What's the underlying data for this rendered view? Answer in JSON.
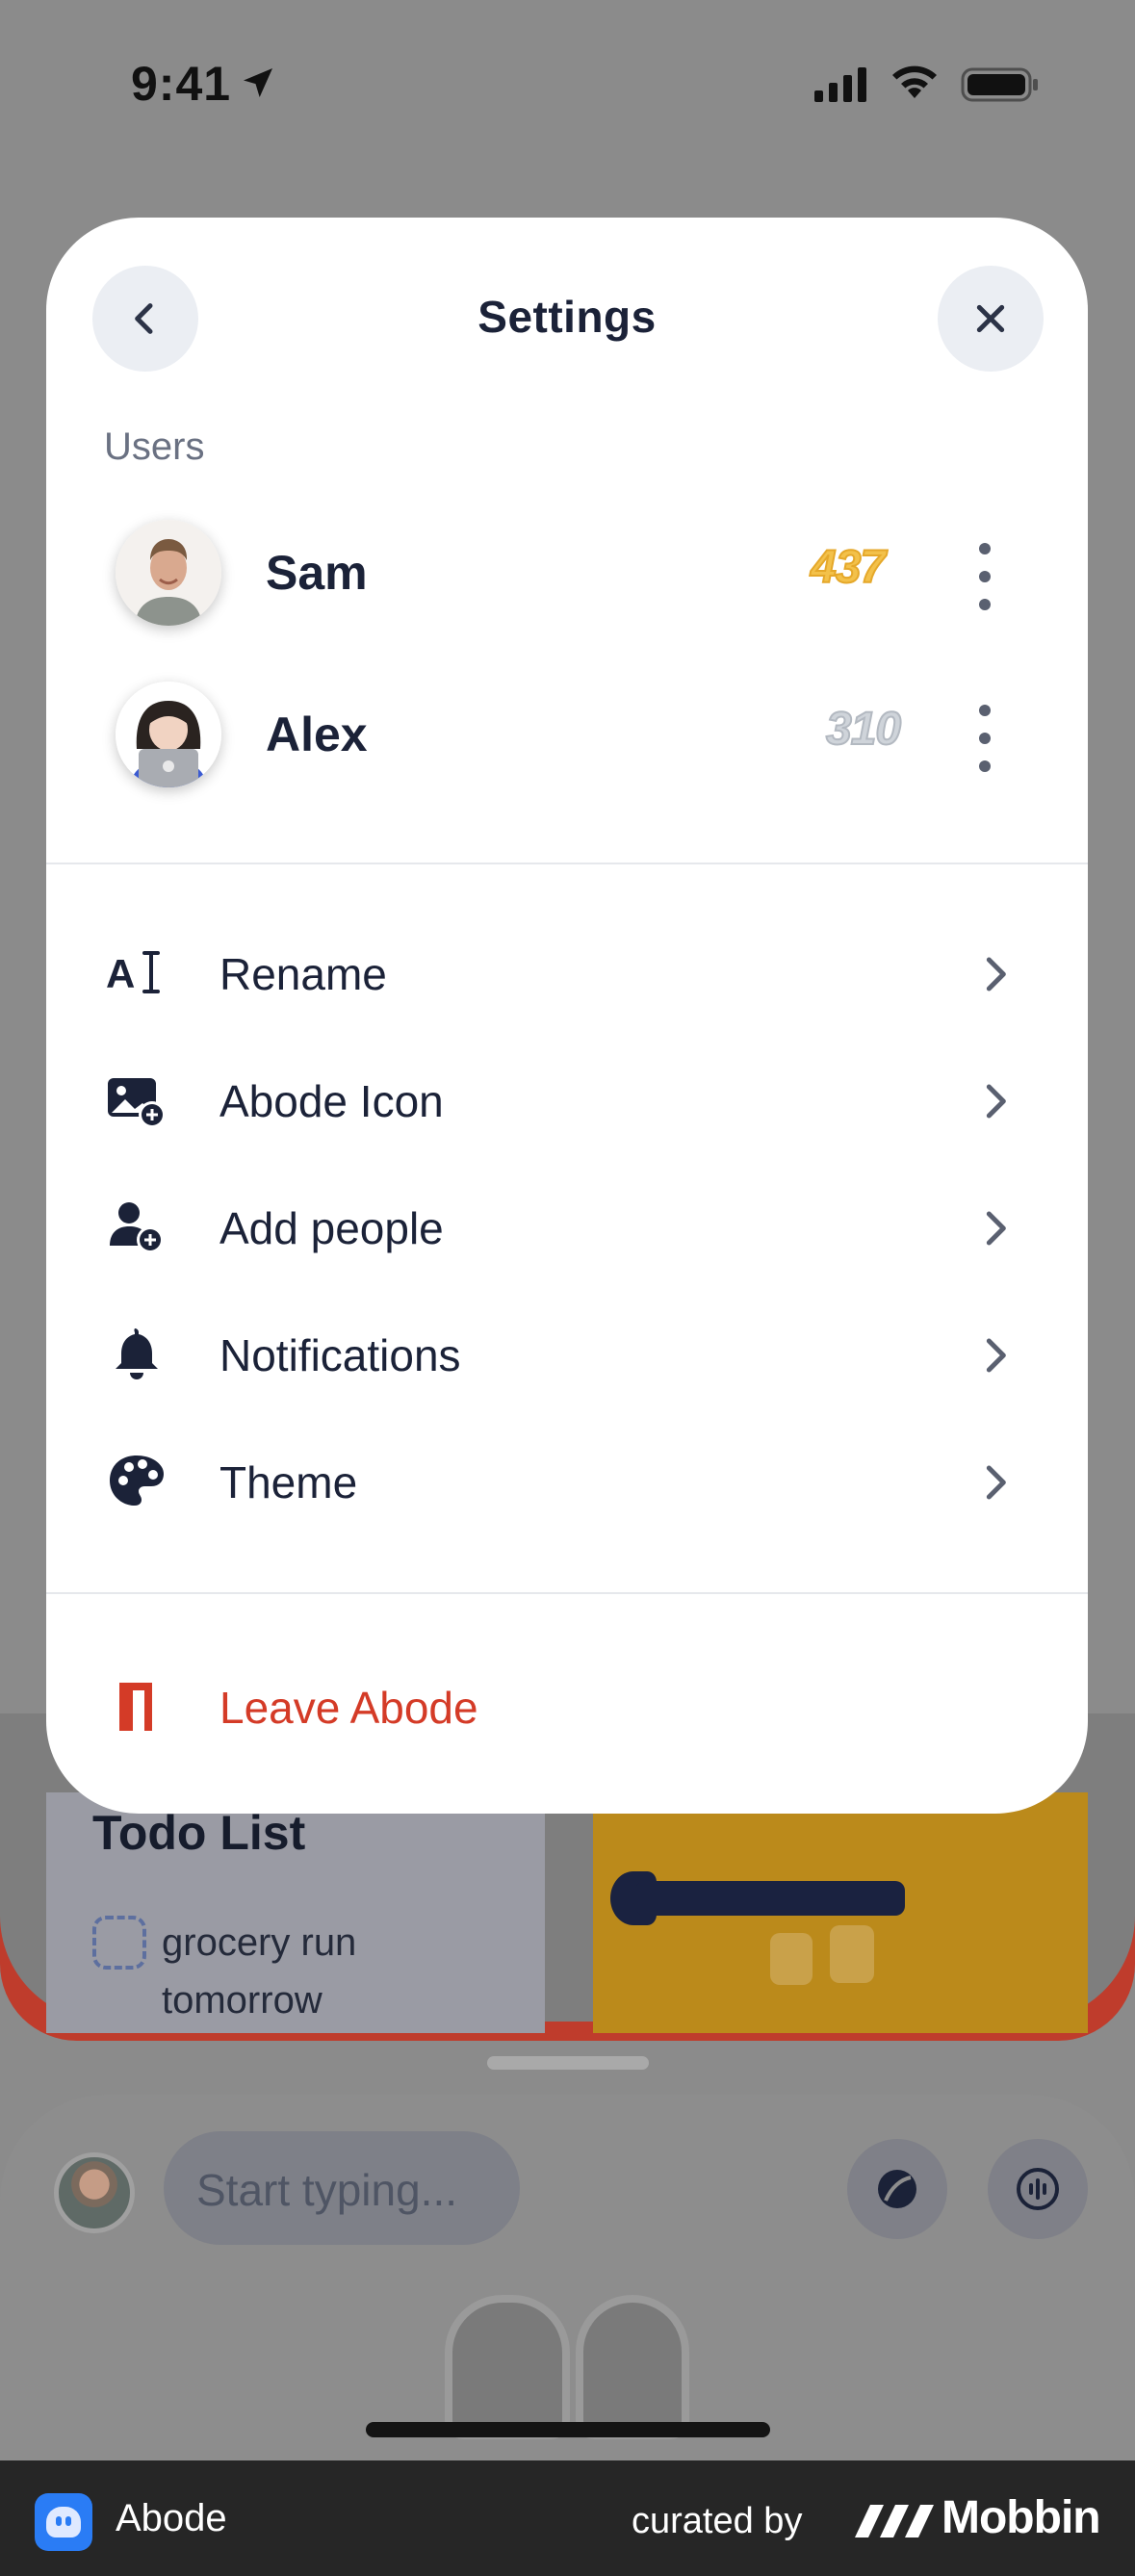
{
  "status_bar": {
    "time": "9:41"
  },
  "sheet": {
    "title": "Settings",
    "users_section_label": "Users",
    "users": [
      {
        "name": "Sam",
        "score": "437",
        "score_color": "#f3c14a"
      },
      {
        "name": "Alex",
        "score": "310",
        "score_color": "#cfd4da"
      }
    ],
    "menu": [
      {
        "label": "Rename",
        "icon": "rename-text-cursor-icon"
      },
      {
        "label": "Abode Icon",
        "icon": "image-add-icon"
      },
      {
        "label": "Add people",
        "icon": "person-add-icon"
      },
      {
        "label": "Notifications",
        "icon": "bell-icon"
      },
      {
        "label": "Theme",
        "icon": "palette-icon"
      }
    ],
    "leave": {
      "label": "Leave Abode",
      "icon": "door-exit-icon",
      "color": "#d43b27"
    }
  },
  "background": {
    "todo_title": "Todo List",
    "todo_item": "grocery run tomorrow",
    "composer_placeholder": "Start typing..."
  },
  "attribution": {
    "app_name": "Abode",
    "curated_by": "curated by",
    "brand": "Mobbin"
  },
  "colors": {
    "accent_dark": "#1b2238",
    "danger": "#d43b27",
    "sheet_bg": "#ffffff",
    "button_bg": "#ebeef3"
  }
}
